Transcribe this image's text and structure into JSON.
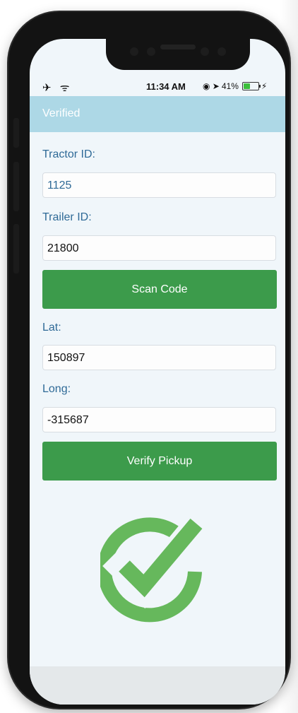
{
  "status_bar": {
    "left_icons": "✈ ᯤ",
    "time": "11:34 AM",
    "right_icons": "◉ ➤",
    "battery_text": "41%",
    "battery_level": 0.41,
    "charging_icon": "⚡"
  },
  "nav": {
    "title": "Verified"
  },
  "form": {
    "tractor_label": "Tractor ID:",
    "tractor_value": "1125",
    "trailer_label": "Trailer ID:",
    "trailer_value": "21800",
    "scan_button": "Scan Code",
    "lat_label": "Lat:",
    "lat_value": "150897",
    "long_label": "Long:",
    "long_value": "-315687",
    "verify_button": "Verify Pickup"
  },
  "icons": {
    "verified": "check-circle-icon"
  },
  "colors": {
    "nav_bg": "#add8e6",
    "button_bg": "#3c9b4b",
    "check_green": "#66b85c",
    "label_blue": "#2f6a97",
    "screen_bg": "#f0f6fa"
  }
}
